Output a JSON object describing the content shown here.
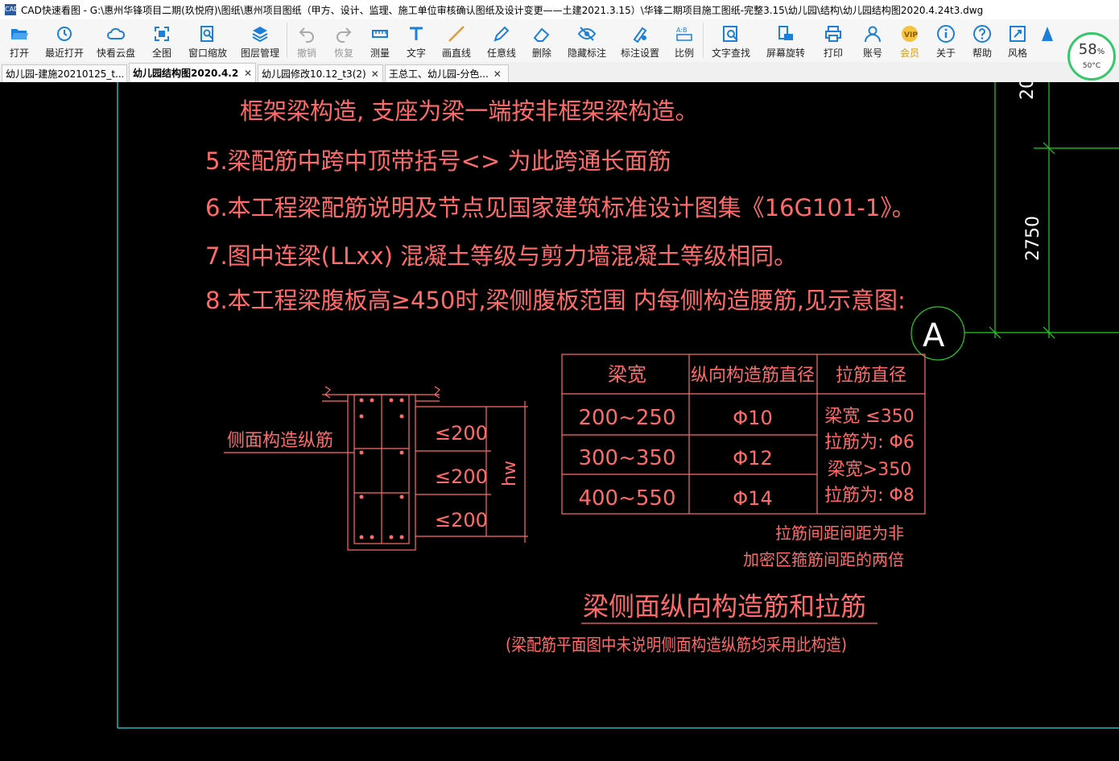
{
  "titlebar": {
    "app_icon": "CAD",
    "title": "CAD快速看图 - G:\\惠州华锋项目二期(玖悦府)\\图纸\\惠州项目图纸（甲方、设计、监理、施工单位审核确认图纸及设计变更——土建2021.3.15）\\华锋二期项目施工图纸-完整3.15\\幼儿园\\结构\\幼儿园结构图2020.4.24t3.dwg"
  },
  "toolbar": {
    "open": "打开",
    "recent": "最近打开",
    "cloud": "快看云盘",
    "fullview": "全图",
    "window_zoom": "窗口缩放",
    "layers": "图层管理",
    "undo": "撤销",
    "redo": "恢复",
    "measure": "测量",
    "text": "文字",
    "line": "画直线",
    "freeline": "任意线",
    "delete": "删除",
    "hide_annot": "隐藏标注",
    "annot_settings": "标注设置",
    "scale": "比例",
    "text_search": "文字查找",
    "rotate": "屏幕旋转",
    "print": "打印",
    "account": "账号",
    "member": "会员",
    "about": "关于",
    "help": "帮助",
    "style": "风格"
  },
  "performance": {
    "percent": "58",
    "percent_unit": "%",
    "temp": "50°C"
  },
  "tabs": [
    {
      "label": "幼儿园-建施20210125_t..."
    },
    {
      "label": "幼儿园结构图2020.4.2..."
    },
    {
      "label": "幼儿园修改10.12_t3(2)"
    },
    {
      "label": "王总工、幼儿园-分色..."
    }
  ],
  "tab_close": "✕",
  "drawing": {
    "line_4": "框架梁构造, 支座为梁一端按非框架梁构造。",
    "line_5": "5.梁配筋中跨中顶带括号<> 为此跨通长面筋",
    "line_6": "6.本工程梁配筋说明及节点见国家建筑标准设计图集《16G101-1》。",
    "line_7": "7.图中连梁(LLxx) 混凝土等级与剪力墙混凝土等级相同。",
    "line_8": "8.本工程梁腹板高≥450时,梁侧腹板范围  内每侧构造腰筋,见示意图:",
    "side_label": "侧面构造纵筋",
    "spacing_1": "≤200",
    "spacing_2": "≤200",
    "spacing_3": "≤200",
    "hw": "hw",
    "dim_top": "20",
    "dim_2750": "2750",
    "axis_a": "A",
    "table": {
      "headers": [
        "梁宽",
        "纵向构造筋直径",
        "拉筋直径"
      ],
      "rows": [
        [
          "200~250",
          "Φ10"
        ],
        [
          "300~350",
          "Φ12"
        ],
        [
          "400~550",
          "Φ14"
        ]
      ],
      "tie_note": [
        "梁宽 ≤350",
        "拉筋为: Φ6",
        "梁宽>350",
        "拉筋为: Φ8"
      ]
    },
    "note_1": "拉筋间距间距为非",
    "note_2": "加密区箍筋间距的两倍",
    "caption": "梁侧面纵向构造筋和拉筋",
    "subcaption": "(梁配筋平面图中未说明侧面构造纵筋均采用此构造)",
    "colors": {
      "red": "#ff6b6b",
      "green": "#1fd21f",
      "cyan": "#21b5b5",
      "white": "#ffffff"
    }
  }
}
